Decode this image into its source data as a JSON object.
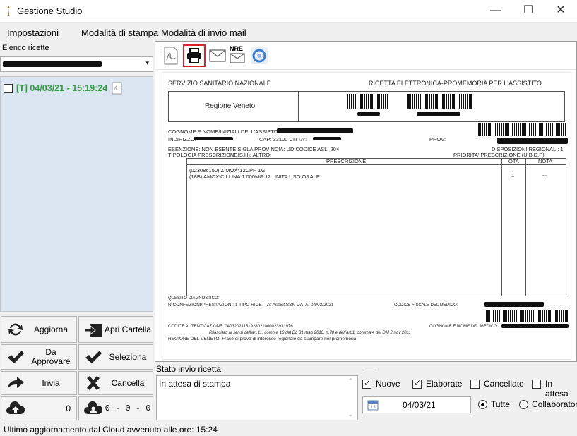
{
  "window": {
    "title": "Gestione Studio",
    "minimize": "—",
    "maximize": "☐",
    "close": "✕"
  },
  "menu": [
    "Impostazioni",
    "Modalità di stampa",
    "Modalità di invio mail"
  ],
  "left": {
    "list_label": "Elenco ricette",
    "list_item": "[T] 04/03/21 - 15:19:24",
    "buttons": {
      "aggiorna": "Aggiorna",
      "apri_cartella": "Apri Cartella",
      "da_approvare": "Da Approvare",
      "seleziona": "Seleziona",
      "invia": "Invia",
      "cancella": "Cancella",
      "cloud_count": "0",
      "cloud_stats": "0 - 0 - 0"
    }
  },
  "toolbar": {
    "nre_label": "NRE"
  },
  "doc": {
    "ssn": "SERVIZIO SANITARIO NAZIONALE",
    "ricetta": "RICETTA ELETTRONICA-PROMEMORIA PER L'ASSISTITO",
    "regione": "Regione Veneto",
    "cognome": "COGNOME E NOME/INIZIALI DELL'ASSISTITO:",
    "indirizzo": "INDIRIZZO:",
    "cap": "CAP: 33100 CITTA':",
    "prov": "PROV:",
    "esenzione": "ESENZIONE: NON ESENTE     SIGLA PROVINCIA: UD   CODICE ASL: 204",
    "disposizioni": "DISPOSIZIONI REGIONALI: 1",
    "tipologia": "TIPOLOGIA PRESCRIZIONE(S,H):       ALTRO:",
    "priorita": "PRIORITA' PRESCRIZIONE (U,B,D,P):",
    "col_prescrizione": "PRESCRIZIONE",
    "col_qta": "QTA",
    "col_nota": "NOTA",
    "line1": "(023086150) ZIMOX*12CPR 1G",
    "line2": "(18B) AMOXICILLINA 1.000MG 12 UNITA USO ORALE",
    "qta1": "1",
    "nota1": "---",
    "quesito": "QUESITO DIAGNOSTICO:",
    "confezioni": "N.CONFEZIONI/PRESTAZIONI: 1     TIPO RICETTA: Assist.SSN     DATA: 04/03/2021",
    "codfisc": "CODICE FISCALE DEL MEDICO:",
    "autent": "CODICE AUTENTICAZIONE: 04032021151928021000023931976",
    "cognome_medico": "COGNOME E NOME DEL MEDICO:",
    "rilasciato": "Rilasciato ai sensi dell'art.11, comma 16 del DL 31 mag 2010, n.78 e dell'art.1, comma 4 del DM 2 nov 2011",
    "frase": "REGIONE DEL VENETO: Frase di prova di interesse regionale da stampare nel promemoria"
  },
  "bottom": {
    "stato_label": "Stato invio ricetta",
    "stato_value": "In attesa di stampa",
    "filters": {
      "nuove": "Nuove",
      "elaborate": "Elaborate",
      "cancellate": "Cancellate",
      "in_attesa": "In attesa"
    },
    "date": "04/03/21",
    "radio_tutte": "Tutte",
    "radio_collab": "Collaboratore"
  },
  "statusbar": "Ultimo aggiornamento dal Cloud avvenuto alle ore: 15:24",
  "colors": {
    "list_bg": "#dce6f2",
    "item_green": "#2e9e3e",
    "highlight": "#d9202b"
  }
}
